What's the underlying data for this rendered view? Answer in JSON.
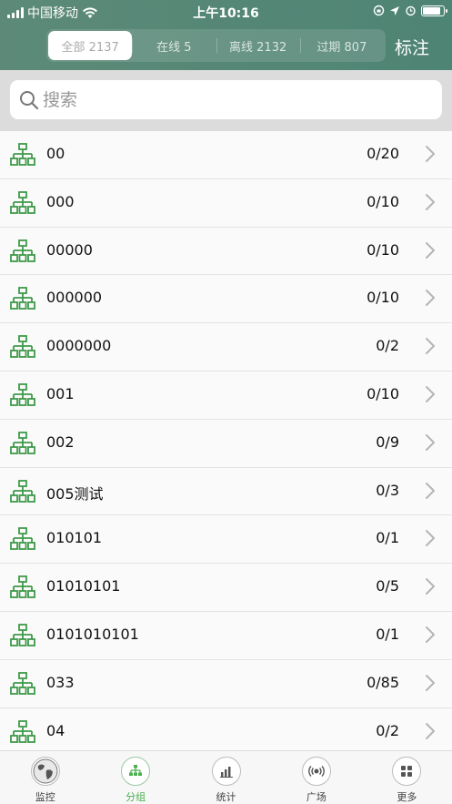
{
  "status_bar": {
    "carrier": "中国移动",
    "time": "上午10:16"
  },
  "header": {
    "segments": [
      {
        "label": "全部 2137",
        "active": true
      },
      {
        "label": "在线 5",
        "active": false
      },
      {
        "label": "离线 2132",
        "active": false
      },
      {
        "label": "过期 807",
        "active": false
      }
    ],
    "mark_label": "标注"
  },
  "search": {
    "placeholder": "搜索"
  },
  "groups": [
    {
      "name": "00",
      "count": "0/20"
    },
    {
      "name": "000",
      "count": "0/10"
    },
    {
      "name": "00000",
      "count": "0/10"
    },
    {
      "name": "000000",
      "count": "0/10"
    },
    {
      "name": "0000000",
      "count": "0/2"
    },
    {
      "name": "001",
      "count": "0/10"
    },
    {
      "name": "002",
      "count": "0/9"
    },
    {
      "name": "005测试",
      "count": "0/3"
    },
    {
      "name": "010101",
      "count": "0/1"
    },
    {
      "name": "01010101",
      "count": "0/5"
    },
    {
      "name": "0101010101",
      "count": "0/1"
    },
    {
      "name": "033",
      "count": "0/85"
    },
    {
      "name": "04",
      "count": "0/2"
    }
  ],
  "tabbar": [
    {
      "label": "监控",
      "icon": "globe-icon",
      "active": false
    },
    {
      "label": "分组",
      "icon": "group-tree-icon",
      "active": true
    },
    {
      "label": "统计",
      "icon": "bar-chart-icon",
      "active": false
    },
    {
      "label": "广场",
      "icon": "broadcast-icon",
      "active": false
    },
    {
      "label": "更多",
      "icon": "grid-icon",
      "active": false
    }
  ],
  "colors": {
    "header_bg": "#5d8a78",
    "accent_green": "#4caf50"
  }
}
